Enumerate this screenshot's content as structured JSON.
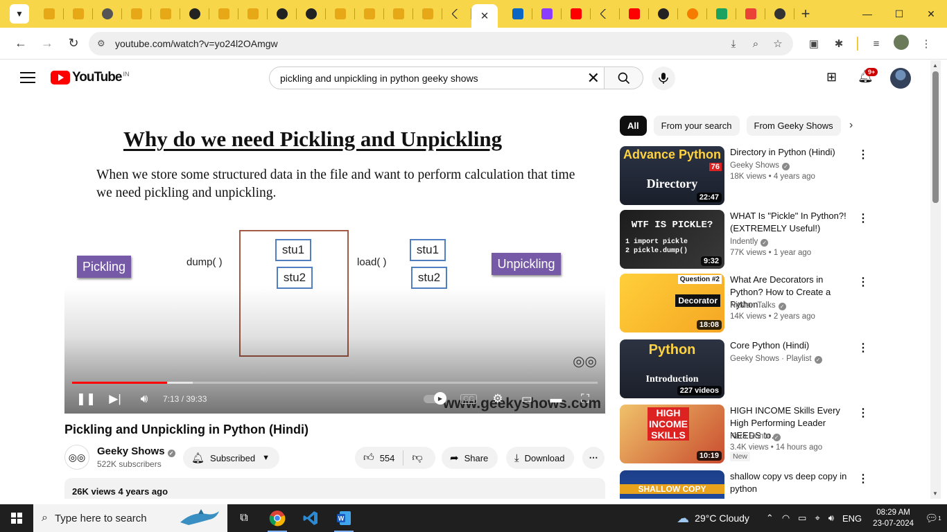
{
  "browser": {
    "url": "youtube.com/watch?v=yo24l2OAmgw",
    "tab_icons": [
      {
        "name": "doc-icon",
        "color": "#e6a817"
      },
      {
        "name": "doc-icon",
        "color": "#e6a817"
      },
      {
        "name": "globe-icon",
        "color": "#555555"
      },
      {
        "name": "doc-icon",
        "color": "#e6a817"
      },
      {
        "name": "doc-icon",
        "color": "#e6a817"
      },
      {
        "name": "github-icon",
        "color": "#222222"
      },
      {
        "name": "doc-icon",
        "color": "#e6a817"
      },
      {
        "name": "doc-icon",
        "color": "#e6a817"
      },
      {
        "name": "github-icon",
        "color": "#222222"
      },
      {
        "name": "github-icon",
        "color": "#222222"
      },
      {
        "name": "doc-icon",
        "color": "#e6a817"
      },
      {
        "name": "doc-icon",
        "color": "#e6a817"
      },
      {
        "name": "sun-icon",
        "color": "#e6a817"
      },
      {
        "name": "doc-icon",
        "color": "#e6a817"
      },
      {
        "name": "chevron-icon",
        "color": "#333333"
      }
    ],
    "tab_icons_right": [
      {
        "name": "linkedin-icon",
        "color": "#0a66c2"
      },
      {
        "name": "p-icon",
        "color": "#8b3dff"
      },
      {
        "name": "youtube-icon",
        "color": "#ff0000"
      },
      {
        "name": "chevron-icon",
        "color": "#333333"
      },
      {
        "name": "youtube-icon",
        "color": "#ff0000"
      },
      {
        "name": "github-icon",
        "color": "#222222"
      },
      {
        "name": "loader-icon",
        "color": "#f57c00"
      },
      {
        "name": "w-icon",
        "color": "#1aa260"
      },
      {
        "name": "gmail-icon",
        "color": "#ea4335"
      },
      {
        "name": "chatgpt-icon",
        "color": "#333333"
      }
    ],
    "active_tab_close": "✕"
  },
  "yt": {
    "logo": "YouTube",
    "country": "IN",
    "search_query": "pickling and unpickling in python geeky shows",
    "notifications": "9+"
  },
  "slide": {
    "title": "Why do we need Pickling and Unpickling",
    "text": "When we store some structured data in the file and want to perform calculation that time we need pickling and unpickling.",
    "pickling": "Pickling",
    "unpickling": "Unpickling",
    "dump": "dump( )",
    "load": "load( )",
    "stu1": "stu1",
    "stu2": "stu2",
    "watermark": "www.geekyshows.com"
  },
  "player": {
    "time": "7:13 / 39:33",
    "progress_fraction": 0.181
  },
  "video": {
    "title": "Pickling and Unpickling in Python (Hindi)",
    "channel": "Geeky Shows",
    "subscribers": "522K subscribers",
    "subscribed_label": "Subscribed",
    "likes": "554",
    "share_label": "Share",
    "download_label": "Download",
    "views_meta": "26K views  4 years ago"
  },
  "sidebar": {
    "chips": [
      "All",
      "From your search",
      "From Geeky Shows"
    ],
    "items": [
      {
        "title": "Directory in Python (Hindi)",
        "channel": "Geeky Shows",
        "meta": "18K views • 4 years ago",
        "duration": "22:47",
        "thumb_top": "Advance Python",
        "thumb_main": "Directory",
        "thumb_num": "76"
      },
      {
        "title": "WHAT Is \"Pickle\" In Python?! (EXTREMELY Useful!)",
        "channel": "Indently",
        "meta": "77K views • 1 year ago",
        "duration": "9:32",
        "thumb_top": "WTF IS PICKLE?",
        "thumb_main": "1 import pickle\n2 pickle.dump()"
      },
      {
        "title": "What Are Decorators in Python? How to Create a Python…",
        "channel": "NitMan Talks",
        "meta": "14K views • 2 years ago",
        "duration": "18:08",
        "thumb_top": "Question #2",
        "thumb_main": "Decorator"
      },
      {
        "title": "Core Python (Hindi)",
        "channel": "Geeky Shows · Playlist",
        "meta": "",
        "duration": "227 videos",
        "thumb_top": "Python",
        "thumb_main": "Introduction"
      },
      {
        "title": "HIGH INCOME Skills Every High Performing Leader NEEDS to…",
        "channel": "Kara Ronin",
        "meta": "3.4K views • 14 hours ago",
        "duration": "10:19",
        "badge": "New",
        "thumb_top": "HIGH INCOME SKILLS"
      },
      {
        "title": "shallow copy vs deep copy in python",
        "channel": "",
        "meta": "",
        "duration": "",
        "thumb_top": "SHALLOW COPY"
      }
    ]
  },
  "taskbar": {
    "search_placeholder": "Type here to search",
    "weather": "29°C  Cloudy",
    "lang": "ENG",
    "time": "08:29 AM",
    "date": "23-07-2024",
    "notif_count": "1"
  }
}
